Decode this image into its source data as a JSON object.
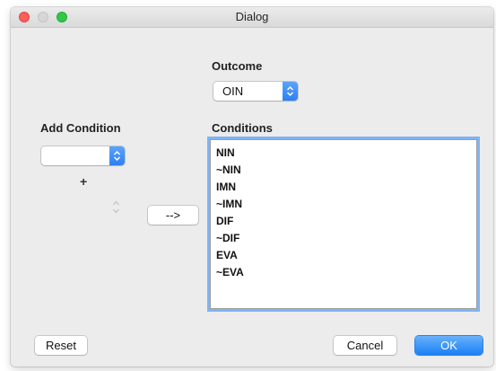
{
  "window": {
    "title": "Dialog"
  },
  "outcome": {
    "label": "Outcome",
    "selected": "OIN"
  },
  "add_condition": {
    "label": "Add Condition",
    "selected": "",
    "plus_symbol": "+"
  },
  "arrow_button": {
    "label": "-->"
  },
  "conditions": {
    "label": "Conditions",
    "items": [
      "NIN",
      "~NIN",
      "IMN",
      "~IMN",
      "DIF",
      "~DIF",
      "EVA",
      "~EVA"
    ]
  },
  "footer": {
    "reset_label": "Reset",
    "cancel_label": "Cancel",
    "ok_label": "OK"
  },
  "colors": {
    "accent": "#2f7ff2",
    "close": "#fc5f57",
    "zoom": "#33c748",
    "window_bg": "#ececec",
    "focus_ring": "#7fb4f5"
  },
  "icons": {
    "popup_arrows": "up-down-chevrons-icon",
    "stepper": "stepper-arrows-icon"
  }
}
